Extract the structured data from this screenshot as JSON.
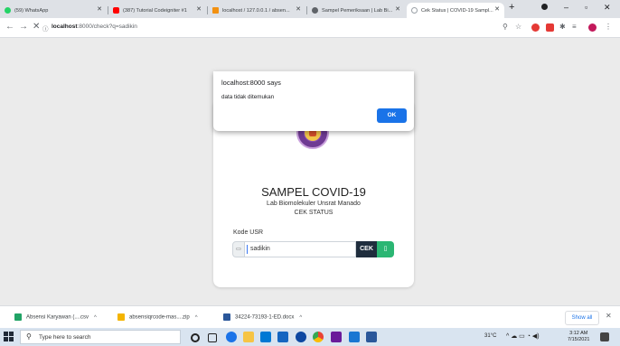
{
  "tabs": [
    {
      "title": "(59) WhatsApp",
      "color": "#25d366"
    },
    {
      "title": "(387) Tutorial Codeigniter #1",
      "color": "#ff0000"
    },
    {
      "title": "localhost / 127.0.0.1 / absen...",
      "color": "#f29111"
    },
    {
      "title": "Sampel Pemeriksaan | Lab Bi...",
      "color": "#5f6368"
    },
    {
      "title": "Cek Status | COVID-19 Sampl...",
      "color": "#9aa0a6"
    }
  ],
  "address": {
    "host": "localhost",
    "path": ":8000/check?q=sadikin"
  },
  "dialog": {
    "title": "localhost:8000 says",
    "message": "data tidak ditemukan",
    "ok": "OK"
  },
  "page": {
    "title": "SAMPEL COVID-19",
    "subtitle": "Lab Biomolekuler Unsrat Manado",
    "subtitle2": "CEK STATUS",
    "label": "Kode USR",
    "input_value": "sadikin",
    "button": "CEK"
  },
  "downloads": [
    {
      "name": "Absensi Karyawan (....csv",
      "color": "#21a366"
    },
    {
      "name": "absensiqrcode-mas....zip",
      "color": "#f4b400"
    },
    {
      "name": "34224-73193-1-ED.docx",
      "color": "#2b579a"
    }
  ],
  "downloads_show_all": "Show all",
  "taskbar": {
    "search_placeholder": "Type here to search",
    "weather": "31°C",
    "time": "3:12 AM",
    "date": "7/15/2021"
  }
}
